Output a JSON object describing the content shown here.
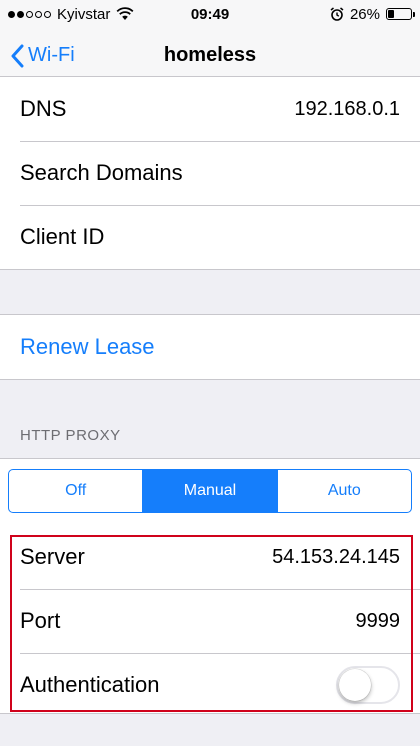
{
  "status_bar": {
    "carrier": "Kyivstar",
    "time": "09:49",
    "battery": "26%",
    "battery_level": 0.26,
    "signal_bars": 2
  },
  "nav": {
    "back_label": "Wi-Fi",
    "title": "homeless"
  },
  "info_rows": [
    {
      "label": "DNS",
      "value": "192.168.0.1"
    },
    {
      "label": "Search Domains",
      "value": ""
    },
    {
      "label": "Client ID",
      "value": ""
    }
  ],
  "renew_lease_label": "Renew Lease",
  "proxy_header": "HTTP PROXY",
  "proxy_modes": {
    "options": [
      "Off",
      "Manual",
      "Auto"
    ],
    "selected": "Manual"
  },
  "proxy_settings": {
    "server_label": "Server",
    "server_value": "54.153.24.145",
    "port_label": "Port",
    "port_value": "9999",
    "auth_label": "Authentication",
    "auth_enabled": false
  },
  "colors": {
    "accent": "#157efb",
    "highlight": "#d0021b",
    "background": "#efeff4"
  }
}
